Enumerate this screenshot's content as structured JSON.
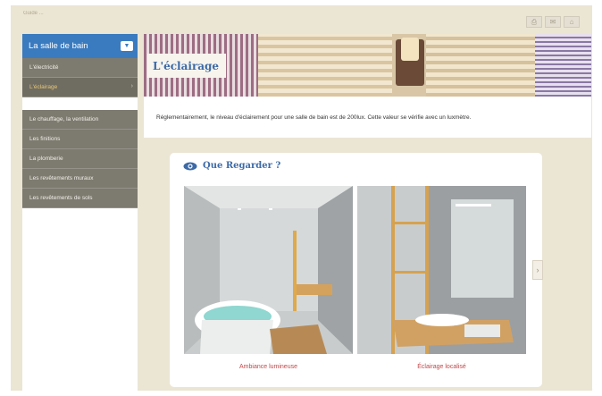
{
  "breadcrumb": "Guide ...",
  "window_controls": [
    "printer-icon",
    "mail-icon",
    "home-icon"
  ],
  "sidebar": {
    "header_label": "La salle de bain",
    "items": [
      {
        "label": "L'électricité",
        "active": false
      },
      {
        "label": "L'éclairage",
        "active": true
      }
    ],
    "sub_items": [
      {
        "label": "Le chauffage, la ventilation"
      },
      {
        "label": "Les finitions"
      },
      {
        "label": "La plomberie"
      },
      {
        "label": "Les revêtements muraux"
      },
      {
        "label": "Les revêtements de sols"
      }
    ]
  },
  "banner": {
    "title": "L'éclairage"
  },
  "info_text": "Réglementairement, le niveau d'éclairement pour une salle de bain est de 200lux. Cette valeur se vérifie avec un luxmètre.",
  "card": {
    "title": "Que Regarder ?",
    "photos": [
      {
        "caption": "Ambiance lumineuse"
      },
      {
        "caption": "Éclairage localisé"
      }
    ]
  },
  "colors": {
    "accent_blue": "#3a7bc0",
    "title_blue": "#3d6aa7",
    "caption_red": "#c2474a",
    "sidebar_gray": "#7d7a70",
    "page_beige": "#ebe5d4"
  }
}
